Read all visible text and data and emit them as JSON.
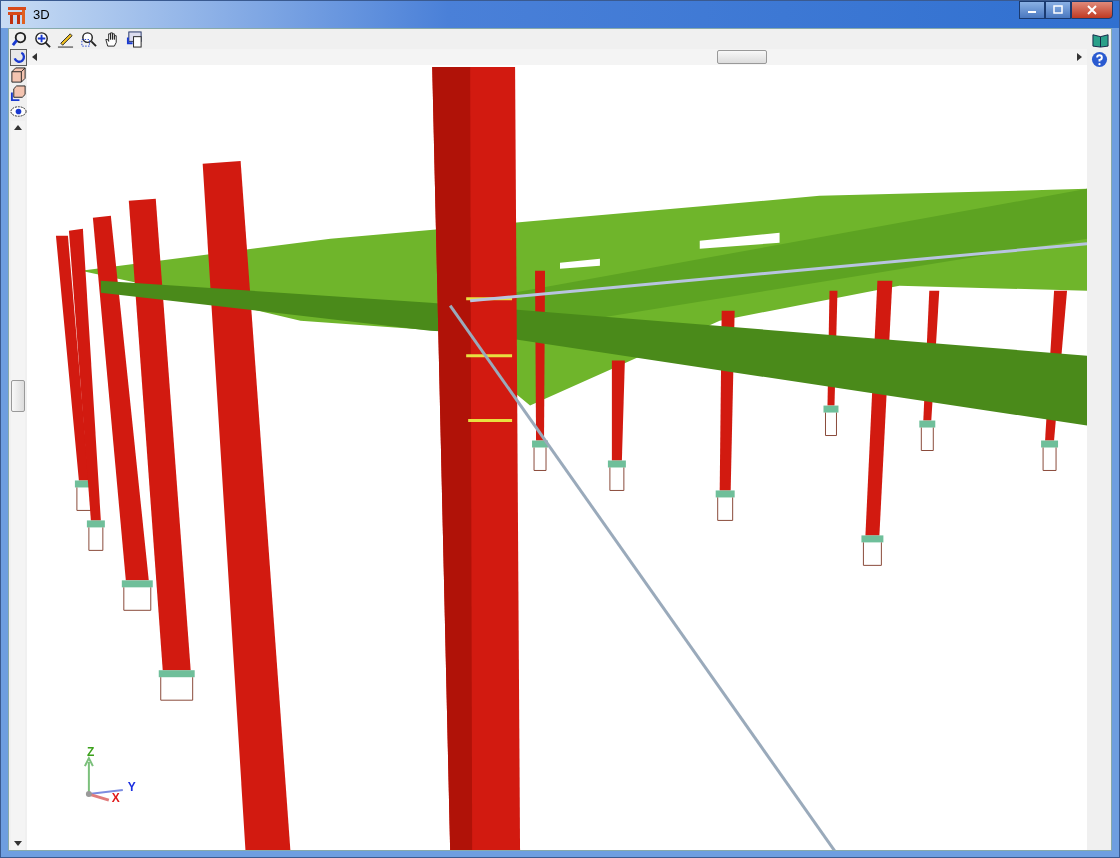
{
  "window": {
    "title": "3D"
  },
  "axis_labels": [
    {
      "label": "Z",
      "color": "#3aa01a"
    },
    {
      "label": "Y",
      "color": "#1a2ee0"
    },
    {
      "label": "X",
      "color": "#e01a1a"
    }
  ]
}
